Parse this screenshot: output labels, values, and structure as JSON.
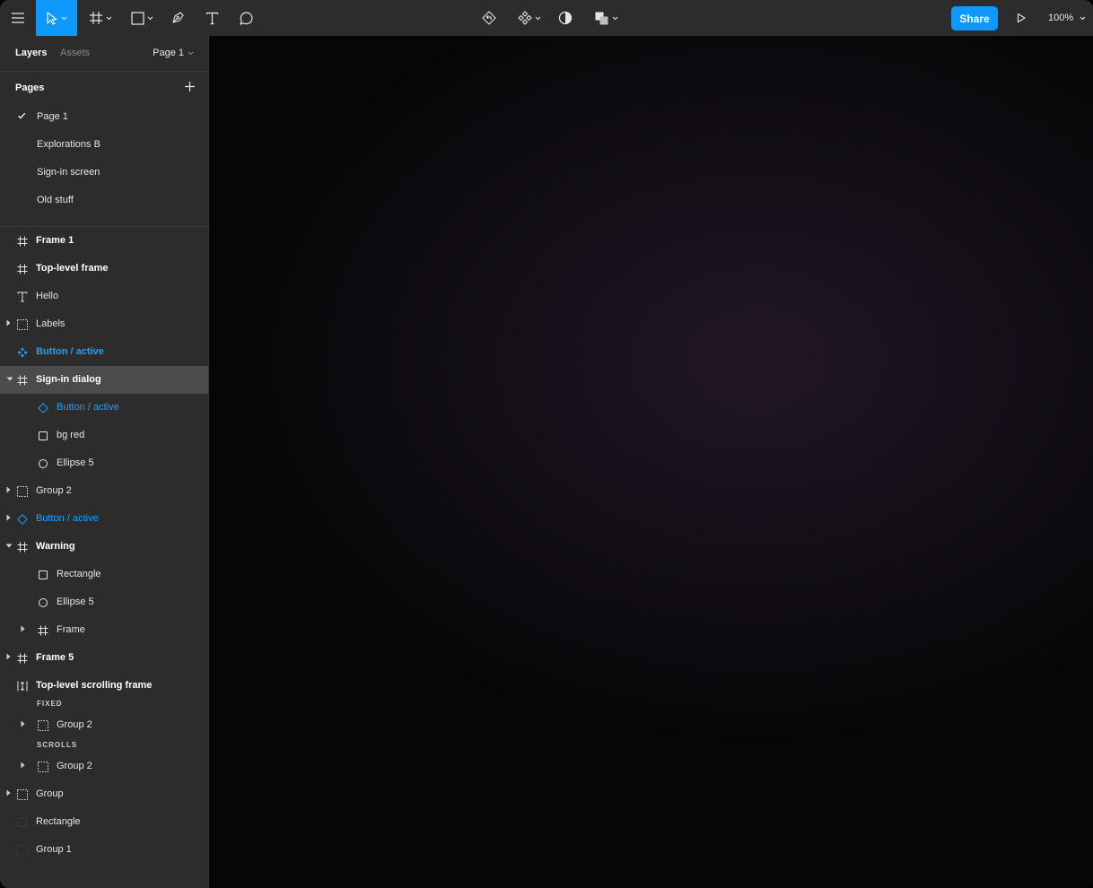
{
  "toolbar": {
    "share_label": "Share",
    "zoom_label": "100%",
    "accent_color": "#0d99ff"
  },
  "sidebar": {
    "tabs": [
      {
        "label": "Layers",
        "active": true
      },
      {
        "label": "Assets",
        "active": false
      }
    ],
    "page_selector": "Page 1",
    "pages_heading": "Pages",
    "pages": [
      {
        "label": "Page 1",
        "selected": true
      },
      {
        "label": "Explorations B",
        "selected": false
      },
      {
        "label": "Sign-in screen",
        "selected": false
      },
      {
        "label": "Old stuff",
        "selected": false
      }
    ],
    "layers": [
      {
        "label": "Frame 1",
        "icon": "frame-icon"
      },
      {
        "label": "Top-level frame",
        "icon": "frame-icon"
      },
      {
        "label": "Hello",
        "icon": "text-icon"
      },
      {
        "label": "Labels",
        "icon": "group-icon"
      },
      {
        "label": "Button / active",
        "icon": "component-icon"
      },
      {
        "label": "Sign-in dialog",
        "icon": "frame-icon",
        "selected": true
      },
      {
        "label": "Button / active",
        "icon": "instance-icon"
      },
      {
        "label": "bg red",
        "icon": "rectangle-icon"
      },
      {
        "label": "Ellipse 5",
        "icon": "ellipse-icon"
      },
      {
        "label": "Group 2",
        "icon": "group-icon"
      },
      {
        "label": "Button / active",
        "icon": "instance-icon"
      },
      {
        "label": "Warning",
        "icon": "frame-icon"
      },
      {
        "label": "Rectangle",
        "icon": "rectangle-icon"
      },
      {
        "label": "Ellipse 5",
        "icon": "ellipse-icon"
      },
      {
        "label": "Frame",
        "icon": "frame-icon"
      },
      {
        "label": "Frame 5",
        "icon": "frame-icon"
      },
      {
        "label": "Top-level scrolling frame",
        "icon": "scroll-frame-icon"
      },
      {
        "label": "Group 2",
        "icon": "group-icon"
      },
      {
        "label": "Group 2",
        "icon": "group-icon"
      },
      {
        "label": "Group",
        "icon": "group-icon"
      },
      {
        "label": "Rectangle",
        "icon": "rectangle-icon"
      },
      {
        "label": "Group 1",
        "icon": "group-icon"
      }
    ],
    "sections": {
      "fixed": "FIXED",
      "scrolls": "SCROLLS"
    }
  }
}
